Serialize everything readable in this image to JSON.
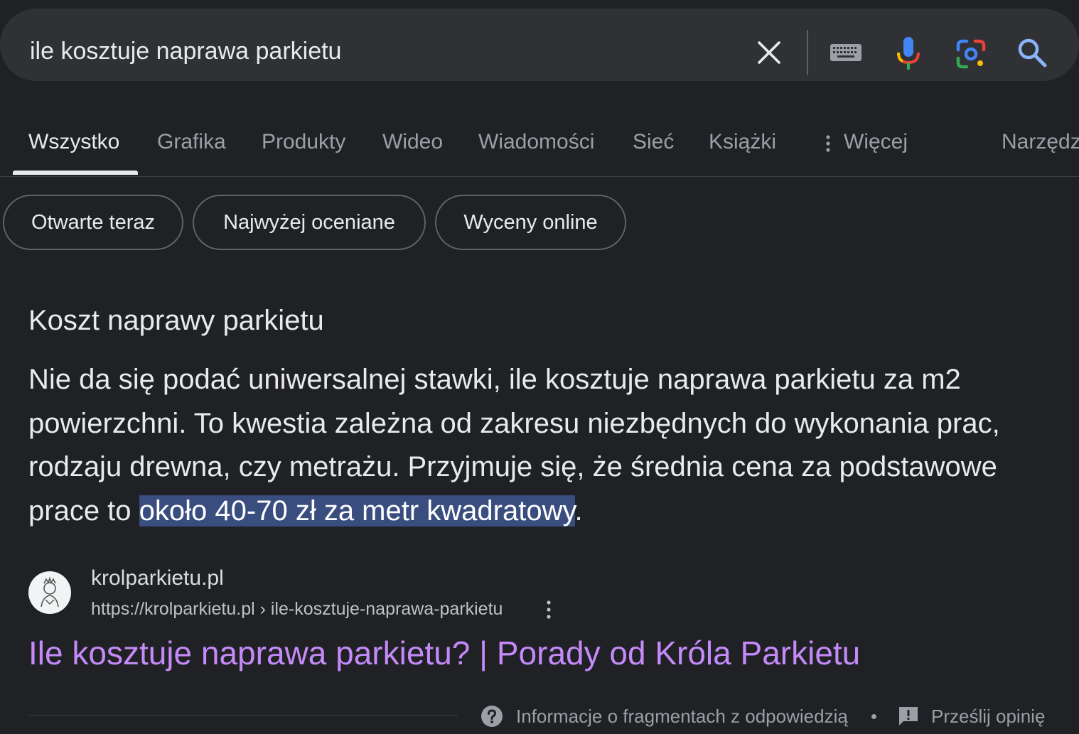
{
  "search": {
    "query": "ile kosztuje naprawa parkietu"
  },
  "tabs": [
    {
      "label": "Wszystko",
      "active": true
    },
    {
      "label": "Grafika"
    },
    {
      "label": "Produkty"
    },
    {
      "label": "Wideo"
    },
    {
      "label": "Wiadomości"
    },
    {
      "label": "Sieć"
    },
    {
      "label": "Książki"
    },
    {
      "label": "Więcej"
    },
    {
      "label": "Narzędz"
    }
  ],
  "chips": [
    {
      "label": "Otwarte teraz"
    },
    {
      "label": "Najwyżej oceniane"
    },
    {
      "label": "Wyceny online"
    }
  ],
  "snippet": {
    "title": "Koszt naprawy parkietu",
    "text_before": "Nie da się podać uniwersalnej stawki, ile kosztuje naprawa parkietu za m2 powierzchni. To kwestia zależna od zakresu niezbędnych do wykonania prac, rodzaju drewna, czy metrażu. Przyjmuje się, że średnia cena za podstawowe prace to ",
    "highlight": "około 40-70 zł za metr kwadratowy",
    "text_after": "."
  },
  "source": {
    "site_name": "krolparkietu.pl",
    "url": "https://krolparkietu.pl › ile-kosztuje-naprawa-parkietu",
    "title": "Ile kosztuje naprawa parkietu? | Porady od Króla Parkietu"
  },
  "footer": {
    "about": "Informacje o fragmentach z odpowiedzią",
    "feedback": "Prześlij opinię"
  },
  "colors": {
    "background": "#202124",
    "search_bg": "#303134",
    "link_visited": "#c58af9",
    "highlight_bg": "#394d7f"
  },
  "icons": [
    "close-icon",
    "keyboard-icon",
    "mic-icon",
    "lens-icon",
    "search-icon",
    "more-vert-icon",
    "help-icon",
    "feedback-icon"
  ]
}
